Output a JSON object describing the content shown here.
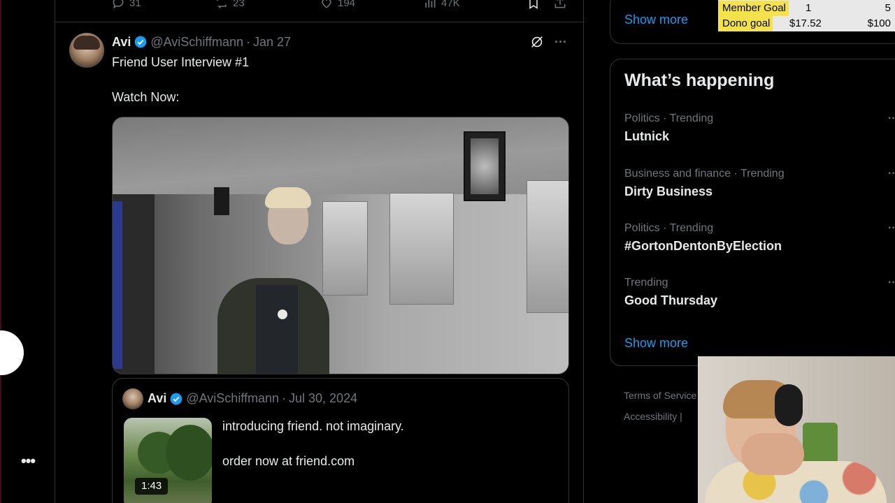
{
  "previous_tweet_actions": {
    "replies": "31",
    "retweets": "23",
    "likes": "194",
    "views": "47K"
  },
  "tweet": {
    "author_name": "Avi",
    "handle": "@AviSchiffmann",
    "separator": "·",
    "date": "Jan 27",
    "text_lines": [
      "Friend User Interview #1",
      "Watch Now:"
    ]
  },
  "quoted_tweet": {
    "author_name": "Avi",
    "handle": "@AviSchiffmann",
    "separator": "·",
    "date": "Jul 30, 2024",
    "video_duration": "1:43",
    "text_lines": [
      "introducing friend. not imaginary.",
      "order now at friend.com"
    ]
  },
  "sidebar_top": {
    "show_more": "Show more"
  },
  "trends": {
    "title": "What’s happening",
    "items": [
      {
        "meta": "Politics · Trending",
        "topic": "Lutnick"
      },
      {
        "meta": "Business and finance · Trending",
        "topic": "Dirty Business"
      },
      {
        "meta": "Politics · Trending",
        "topic": "#GortonDentonByElection"
      },
      {
        "meta": "Trending",
        "topic": "Good Thursday"
      }
    ],
    "more_glyph": "···",
    "show_more": "Show more"
  },
  "footer": {
    "links": [
      "Terms of Service",
      "Accessibility  |"
    ]
  },
  "goals": {
    "member": {
      "label": "Member Goal",
      "current": "1",
      "target": "5"
    },
    "dono": {
      "label": "Dono goal",
      "current": "$17.52",
      "target": "$100"
    }
  },
  "left_nav": {
    "more_glyph": "•••"
  },
  "colors": {
    "accent": "#1d9bf0",
    "background": "#000000",
    "border": "#2f3336",
    "muted": "#71767b",
    "goal_highlight": "#f3e24a"
  }
}
